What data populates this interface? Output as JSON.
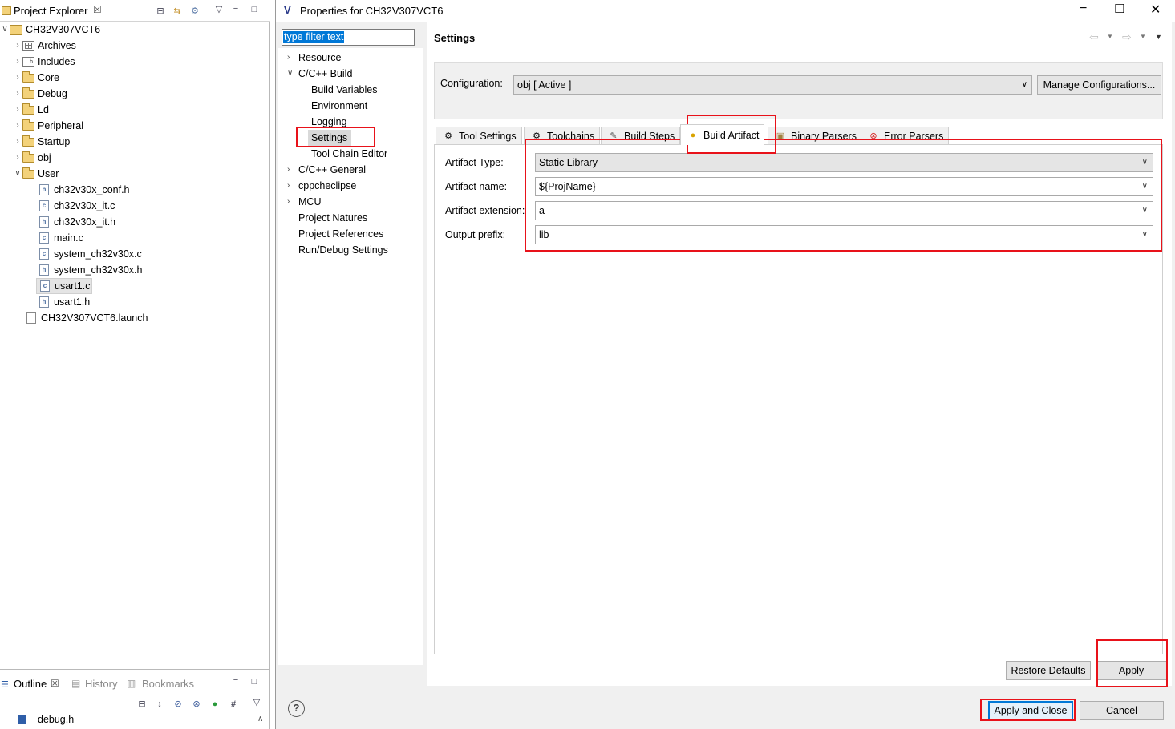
{
  "project_explorer": {
    "title": "Project Explorer",
    "tree": [
      {
        "label": "CH32V307VCT6"
      },
      {
        "label": "Archives"
      },
      {
        "label": "Includes"
      },
      {
        "label": "Core"
      },
      {
        "label": "Debug"
      },
      {
        "label": "Ld"
      },
      {
        "label": "Peripheral"
      },
      {
        "label": "Startup"
      },
      {
        "label": "obj"
      },
      {
        "label": "User"
      },
      {
        "label": "ch32v30x_conf.h"
      },
      {
        "label": "ch32v30x_it.c"
      },
      {
        "label": "ch32v30x_it.h"
      },
      {
        "label": "main.c"
      },
      {
        "label": "system_ch32v30x.c"
      },
      {
        "label": "system_ch32v30x.h"
      },
      {
        "label": "usart1.c"
      },
      {
        "label": "usart1.h"
      },
      {
        "label": "CH32V307VCT6.launch"
      }
    ]
  },
  "outline": {
    "tabs": [
      "Outline",
      "History",
      "Bookmarks"
    ],
    "item": "debug.h"
  },
  "dialog": {
    "title": "Properties for CH32V307VCT6",
    "filter_value": "type filter text",
    "nav": [
      "Resource",
      "C/C++ Build",
      "Build Variables",
      "Environment",
      "Logging",
      "Settings",
      "Tool Chain Editor",
      "C/C++ General",
      "cppcheclipse",
      "MCU",
      "Project Natures",
      "Project References",
      "Run/Debug Settings"
    ],
    "section_title": "Settings",
    "configuration_label": "Configuration:",
    "configuration_value": "obj  [ Active ]",
    "manage_button": "Manage Configurations...",
    "tabs": [
      "Tool Settings",
      "Toolchains",
      "Build Steps",
      "Build Artifact",
      "Binary Parsers",
      "Error Parsers"
    ],
    "fields": [
      {
        "label": "Artifact Type:",
        "value": "Static Library"
      },
      {
        "label": "Artifact name:",
        "value": "${ProjName}"
      },
      {
        "label": "Artifact extension:",
        "value": "a"
      },
      {
        "label": "Output prefix:",
        "value": "lib"
      }
    ],
    "restore_button": "Restore Defaults",
    "apply_button": "Apply",
    "apply_close_button": "Apply and Close",
    "cancel_button": "Cancel",
    "help_symbol": "?"
  },
  "colors": {
    "highlight_red": "#e8121a",
    "selection_blue": "#0078d7"
  }
}
